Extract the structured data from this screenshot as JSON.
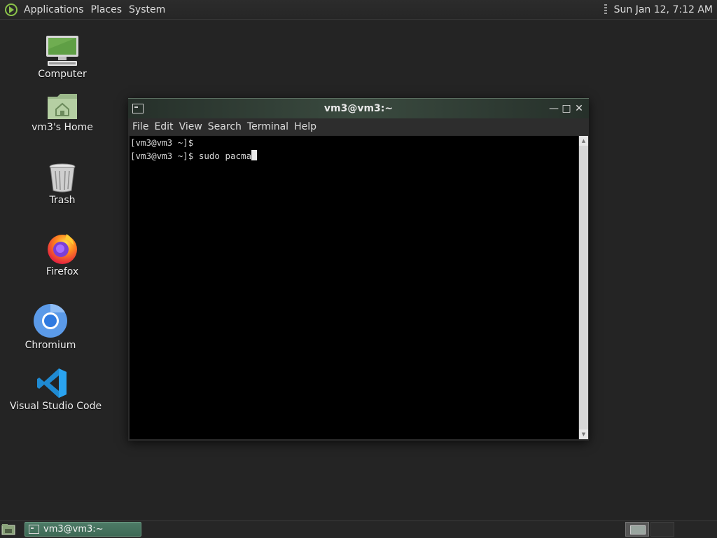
{
  "top_panel": {
    "menus": [
      "Applications",
      "Places",
      "System"
    ],
    "clock": "Sun Jan 12,  7:12 AM"
  },
  "desktop_icons": [
    {
      "label": "Computer",
      "icon": "computer-icon"
    },
    {
      "label": "vm3's Home",
      "icon": "home-folder-icon"
    },
    {
      "label": "Trash",
      "icon": "trash-icon"
    },
    {
      "label": "Firefox",
      "icon": "firefox-icon"
    },
    {
      "label": "Chromium",
      "icon": "chromium-icon"
    },
    {
      "label": "Visual Studio Code",
      "icon": "vscode-icon"
    }
  ],
  "terminal": {
    "title": "vm3@vm3:~",
    "menus": [
      "File",
      "Edit",
      "View",
      "Search",
      "Terminal",
      "Help"
    ],
    "lines": [
      "[vm3@vm3 ~]$",
      "[vm3@vm3 ~]$ sudo pacma"
    ]
  },
  "taskbar": {
    "task_label": "vm3@vm3:~"
  },
  "colors": {
    "desktop_bg": "#242424",
    "accent_green": "#4d7a66",
    "terminal_bg": "#000000"
  }
}
